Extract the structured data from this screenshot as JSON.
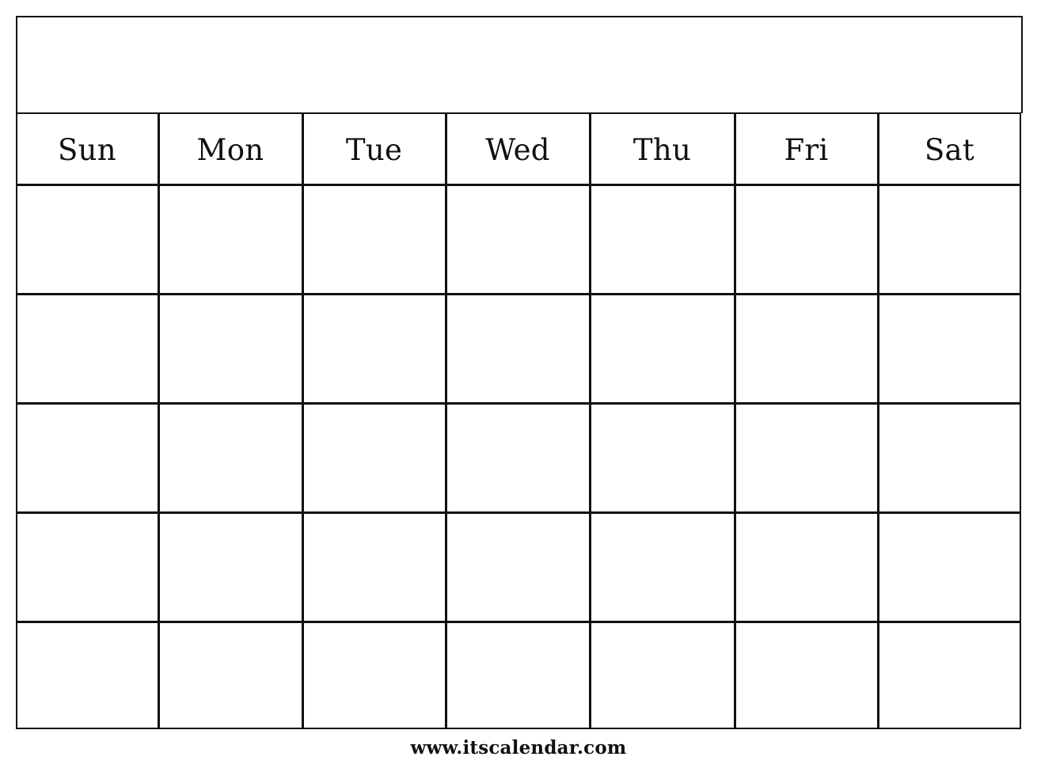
{
  "calendar": {
    "title": "",
    "weekdays": [
      "Sun",
      "Mon",
      "Tue",
      "Wed",
      "Thu",
      "Fri",
      "Sat"
    ],
    "weeks": [
      [
        "",
        "",
        "",
        "",
        "",
        "",
        ""
      ],
      [
        "",
        "",
        "",
        "",
        "",
        "",
        ""
      ],
      [
        "",
        "",
        "",
        "",
        "",
        "",
        ""
      ],
      [
        "",
        "",
        "",
        "",
        "",
        "",
        ""
      ],
      [
        "",
        "",
        "",
        "",
        "",
        "",
        ""
      ]
    ]
  },
  "footer": {
    "website": "www.itscalendar.com"
  },
  "colors": {
    "line": "#111111",
    "background": "#ffffff"
  }
}
